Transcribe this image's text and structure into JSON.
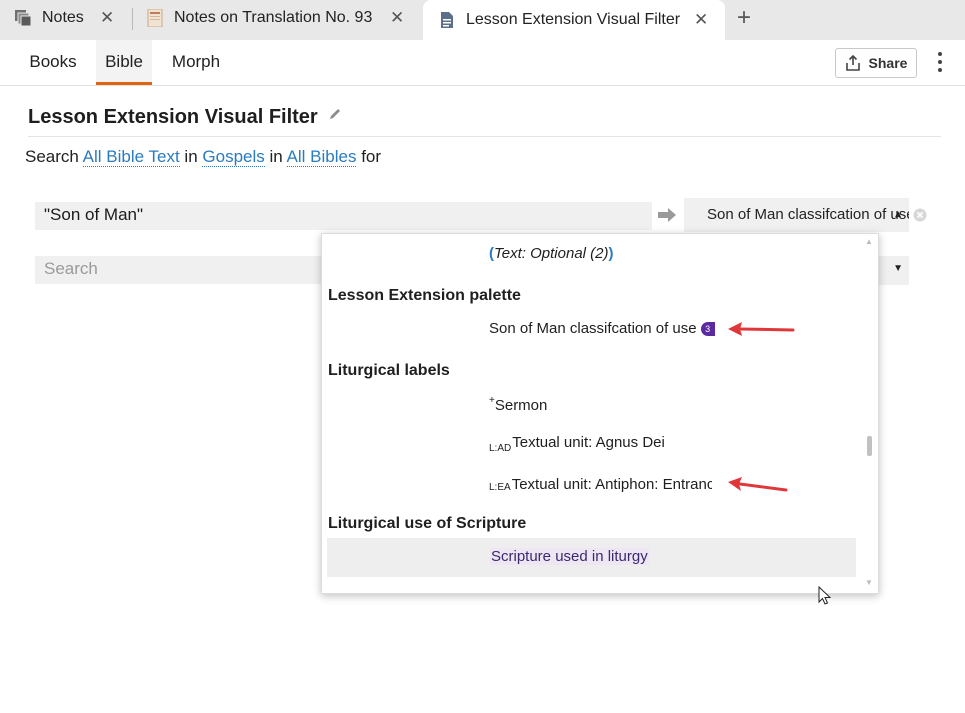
{
  "tabs": [
    {
      "label": "Notes",
      "icon": "notes-stack-icon",
      "close": "✕"
    },
    {
      "label": "Notes on Translation No. 93",
      "icon": "book-cover-icon",
      "close": "✕"
    },
    {
      "label": "Lesson Extension Visual Filter",
      "icon": "document-icon",
      "close": "✕",
      "active": true
    }
  ],
  "new_tab": "+",
  "subtabs": [
    {
      "label": "Books"
    },
    {
      "label": "Bible",
      "active": true
    },
    {
      "label": "Morph"
    }
  ],
  "share": {
    "label": "Share",
    "icon": "share-icon"
  },
  "page": {
    "title": "Lesson Extension Visual Filter",
    "search_line": {
      "prefix": "Search",
      "scope1": "All Bible Text",
      "in1": "in",
      "scope2": "Gospels",
      "in2": "in",
      "scope3": "All Bibles",
      "suffix": "for"
    },
    "query_value": "\"Son of Man\"",
    "search_placeholder": "Search",
    "label_select_value": "Son of Man classifcation of use"
  },
  "dropdown": {
    "optional_row": {
      "open": "(",
      "text": "Text: Optional (2)",
      "close": ")"
    },
    "groups": [
      {
        "title": "Lesson Extension palette",
        "items": [
          {
            "text": "Son of Man classifcation of use",
            "badge": "3"
          }
        ]
      },
      {
        "title": "Liturgical labels",
        "items": [
          {
            "prefix": "+",
            "text": "Sermon"
          },
          {
            "prefix": "L:AD",
            "text": "Textual unit: Agnus Dei"
          },
          {
            "prefix": "L:EA",
            "text": "Textual unit: Antiphon: Entrance"
          }
        ]
      },
      {
        "title": "Liturgical use of Scripture",
        "items": [
          {
            "text": "Scripture used in liturgy",
            "highlighted": true
          }
        ]
      }
    ]
  },
  "colors": {
    "accent": "#e2640e",
    "link": "#2a7bbf",
    "badge": "#5b2aa0",
    "annotation": "#e0383a"
  }
}
